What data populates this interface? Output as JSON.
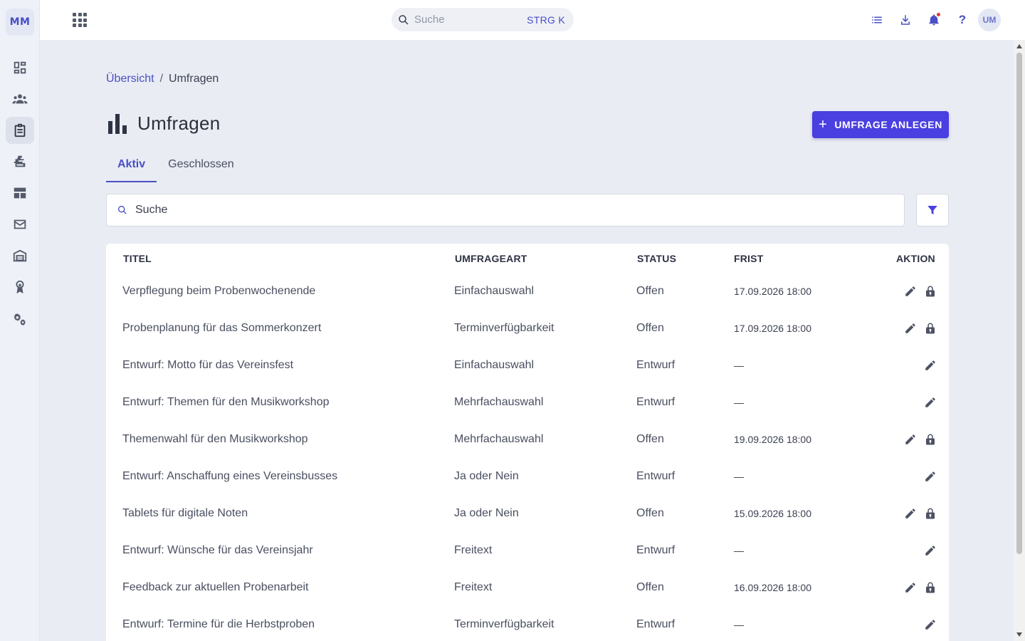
{
  "sidebar": {
    "logo": "MM",
    "items": [
      {
        "name": "dashboard"
      },
      {
        "name": "members"
      },
      {
        "name": "surveys",
        "active": true
      },
      {
        "name": "events"
      },
      {
        "name": "layout"
      },
      {
        "name": "mail"
      },
      {
        "name": "inventory"
      },
      {
        "name": "awards"
      },
      {
        "name": "settings"
      }
    ]
  },
  "topbar": {
    "search_placeholder": "Suche",
    "shortcut": "STRG K",
    "help": "?",
    "avatar": "UM",
    "notification_dot_color": "#e53935"
  },
  "breadcrumb": {
    "home": "Übersicht",
    "separator": "/",
    "current": "Umfragen"
  },
  "page": {
    "title": "Umfragen",
    "create_button": "UMFRAGE ANLEGEN",
    "create_button_icon": "+",
    "accent_color": "#4a3fe0"
  },
  "tabs": {
    "active": "Aktiv",
    "closed": "Geschlossen"
  },
  "search": {
    "placeholder": "Suche"
  },
  "table": {
    "headers": {
      "title": "TITEL",
      "type": "UMFRAGEART",
      "status": "STATUS",
      "deadline": "FRIST",
      "action": "AKTION"
    },
    "rows": [
      {
        "title": "Verpflegung beim Probenwochenende",
        "type": "Einfachauswahl",
        "status": "Offen",
        "deadline": "17.09.2026 18:00",
        "lock": true
      },
      {
        "title": "Probenplanung für das Sommerkonzert",
        "type": "Terminverfügbarkeit",
        "status": "Offen",
        "deadline": "17.09.2026 18:00",
        "lock": true
      },
      {
        "title": "Entwurf: Motto für das Vereinsfest",
        "type": "Einfachauswahl",
        "status": "Entwurf",
        "deadline": "—",
        "lock": false
      },
      {
        "title": "Entwurf: Themen für den Musikworkshop",
        "type": "Mehrfachauswahl",
        "status": "Entwurf",
        "deadline": "—",
        "lock": false
      },
      {
        "title": "Themenwahl für den Musikworkshop",
        "type": "Mehrfachauswahl",
        "status": "Offen",
        "deadline": "19.09.2026 18:00",
        "lock": true
      },
      {
        "title": "Entwurf: Anschaffung eines Vereinsbusses",
        "type": "Ja oder Nein",
        "status": "Entwurf",
        "deadline": "—",
        "lock": false
      },
      {
        "title": "Tablets für digitale Noten",
        "type": "Ja oder Nein",
        "status": "Offen",
        "deadline": "15.09.2026 18:00",
        "lock": true
      },
      {
        "title": "Entwurf: Wünsche für das Vereinsjahr",
        "type": "Freitext",
        "status": "Entwurf",
        "deadline": "—",
        "lock": false
      },
      {
        "title": "Feedback zur aktuellen Probenarbeit",
        "type": "Freitext",
        "status": "Offen",
        "deadline": "16.09.2026 18:00",
        "lock": true
      },
      {
        "title": "Entwurf: Termine für die Herbstproben",
        "type": "Terminverfügbarkeit",
        "status": "Entwurf",
        "deadline": "—",
        "lock": false
      }
    ]
  }
}
